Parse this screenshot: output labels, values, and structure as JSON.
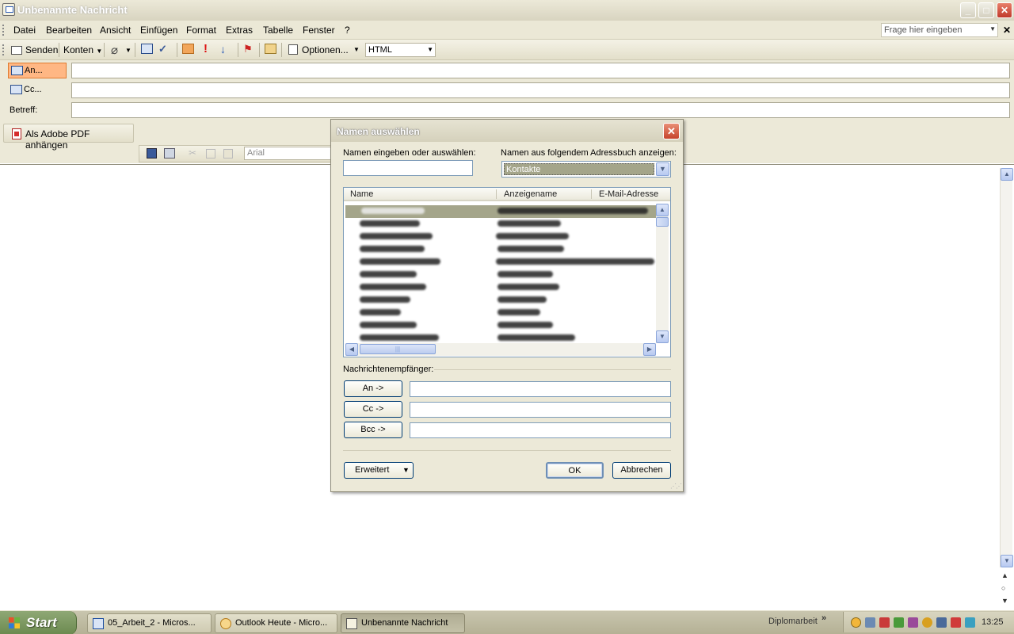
{
  "window": {
    "title": "Unbenannte Nachricht"
  },
  "menu": {
    "items": [
      "Datei",
      "Bearbeiten",
      "Ansicht",
      "Einfügen",
      "Format",
      "Extras",
      "Tabelle",
      "Fenster",
      "?"
    ],
    "ask_placeholder": "Frage hier eingeben"
  },
  "toolbar": {
    "send_label": "Senden",
    "accounts_label": "Konten",
    "options_label": "Optionen...",
    "format_value": "HTML"
  },
  "address": {
    "to_label": "An...",
    "cc_label": "Cc...",
    "subject_label": "Betreff:"
  },
  "adobe": {
    "attach_label": "Als Adobe PDF anhängen"
  },
  "format_toolbar": {
    "font_value": "Arial"
  },
  "dialog": {
    "title": "Namen auswählen",
    "name_input_label": "Namen eingeben oder auswählen:",
    "book_label": "Namen aus folgendem Adressbuch anzeigen:",
    "book_value": "Kontakte",
    "columns": [
      "Name",
      "Anzeigename",
      "E-Mail-Adresse"
    ],
    "recipients_label": "Nachrichtenempfänger:",
    "to_btn": "An ->",
    "cc_btn": "Cc ->",
    "bcc_btn": "Bcc ->",
    "advanced_btn": "Erweitert",
    "ok_btn": "OK",
    "cancel_btn": "Abbrechen"
  },
  "taskbar": {
    "start_label": "Start",
    "tasks": [
      "05_Arbeit_2 - Micros...",
      "Outlook Heute - Micro...",
      "Unbenannte Nachricht"
    ],
    "tray_label": "Diplomarbeit",
    "clock": "13:25"
  },
  "colors": {
    "selection": "#a4a58a",
    "active_field": "#ffb784",
    "dialog_bg": "#ece9d8"
  }
}
